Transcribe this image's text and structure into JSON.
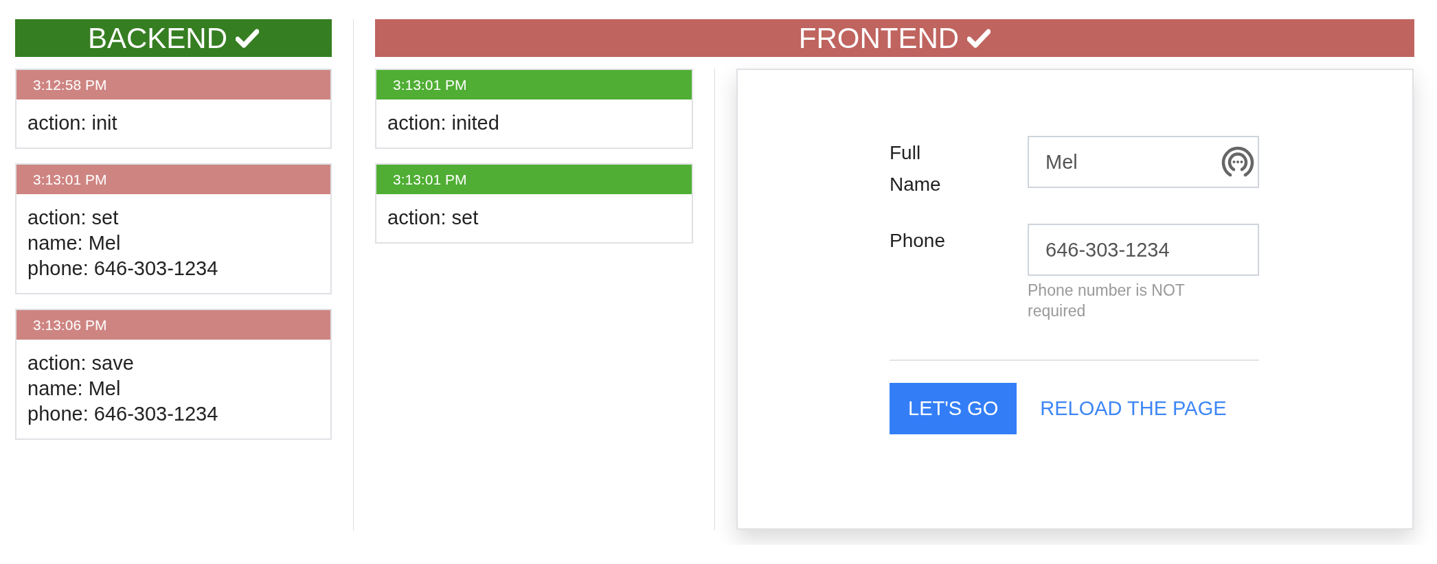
{
  "backend": {
    "title": "BACKEND",
    "color": "#367e22",
    "entries": [
      {
        "time": "3:12:58 PM",
        "color": "#ce8582",
        "lines": [
          "action: init"
        ]
      },
      {
        "time": "3:13:01 PM",
        "color": "#ce8582",
        "lines": [
          "action: set",
          "name: Mel",
          "phone: 646-303-1234"
        ]
      },
      {
        "time": "3:13:06 PM",
        "color": "#ce8582",
        "lines": [
          "action: save",
          "name: Mel",
          "phone: 646-303-1234"
        ]
      }
    ]
  },
  "frontend": {
    "title": "FRONTEND",
    "color": "#bf645f",
    "entries": [
      {
        "time": "3:13:01 PM",
        "color": "#4fae33",
        "lines": [
          "action: inited"
        ]
      },
      {
        "time": "3:13:01 PM",
        "color": "#4fae33",
        "lines": [
          "action: set"
        ]
      }
    ],
    "form": {
      "fields": [
        {
          "label": "Full Name",
          "value": "Mel",
          "kind": "autofill"
        },
        {
          "label": "Phone",
          "value": "646-303-1234",
          "kind": "plain",
          "help": "Phone number is NOT required"
        }
      ],
      "submit": "LET'S GO",
      "link": "RELOAD THE PAGE"
    }
  }
}
